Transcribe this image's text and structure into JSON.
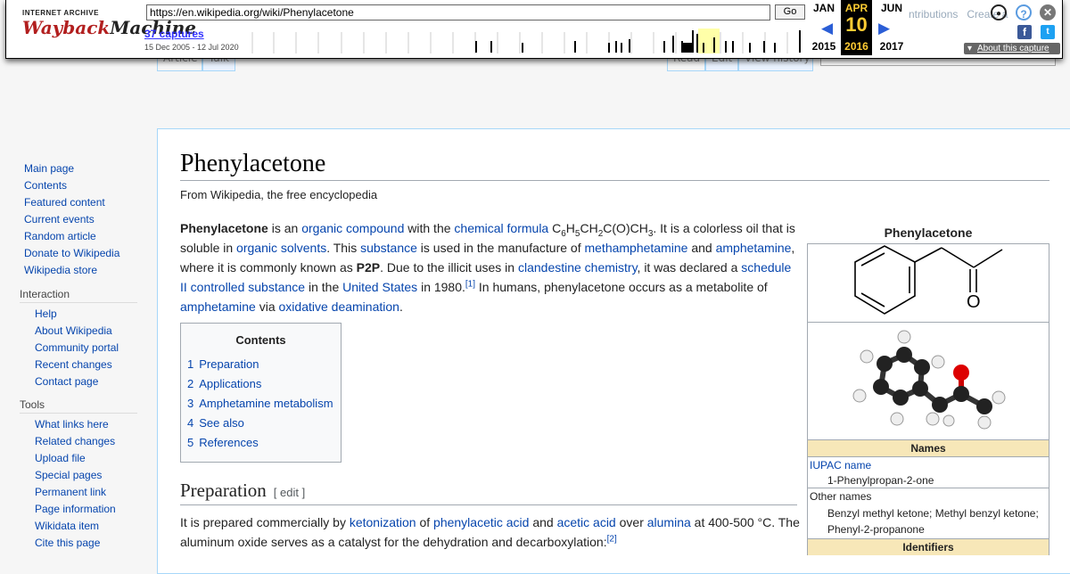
{
  "wayback": {
    "logo_top": "INTERNET ARCHIVE",
    "logo_w": "Wayback",
    "logo_m": "Machine",
    "url": "https://en.wikipedia.org/wiki/Phenylacetone",
    "go_label": "Go",
    "captures": "37 captures",
    "range": "15 Dec 2005 - 12 Jul 2020",
    "prev_month": "JAN",
    "prev_year": "2015",
    "cur_month": "APR",
    "cur_day": "10",
    "cur_year": "2016",
    "next_month": "JUN",
    "next_year": "2017",
    "about": "About this capture",
    "ghost_right": "ntributions   Create a"
  },
  "ghost_tabs": {
    "article": "Article",
    "talk": "Talk",
    "read": "Read",
    "edit": "Edit",
    "history": "View history"
  },
  "sidebar": {
    "main": [
      "Main page",
      "Contents",
      "Featured content",
      "Current events",
      "Random article",
      "Donate to Wikipedia",
      "Wikipedia store"
    ],
    "interaction_label": "Interaction",
    "interaction": [
      "Help",
      "About Wikipedia",
      "Community portal",
      "Recent changes",
      "Contact page"
    ],
    "tools_label": "Tools",
    "tools": [
      "What links here",
      "Related changes",
      "Upload file",
      "Special pages",
      "Permanent link",
      "Page information",
      "Wikidata item",
      "Cite this page"
    ]
  },
  "article": {
    "title": "Phenylacetone",
    "from": "From Wikipedia, the free encyclopedia",
    "lead": {
      "b1": "Phenylacetone",
      "t1": " is an ",
      "l1": "organic compound",
      "t2": " with the ",
      "l2": "chemical formula",
      "f1": " C",
      "s1": "6",
      "f2": "H",
      "s2": "5",
      "f3": "CH",
      "s3": "2",
      "f4": "C(O)CH",
      "s4": "3",
      "t3": ". It is a colorless oil that is soluble in ",
      "l3": "organic solvents",
      "t4": ". This ",
      "l4": "substance",
      "t5": " is used in the manufacture of ",
      "l5": "methamphetamine",
      "t6": " and ",
      "l6": "amphetamine",
      "t7": ", where it is commonly known as ",
      "b2": "P2P",
      "t8": ". Due to the illicit uses in ",
      "l7": "clandestine chemistry",
      "t9": ", it was declared a ",
      "l8": "schedule II controlled substance",
      "t10": " in the ",
      "l9": "United States",
      "t11": " in 1980.",
      "r1": "[1]",
      "t12": " In humans, phenylacetone occurs as a metabolite of ",
      "l10": "amphetamine",
      "t13": " via ",
      "l11": "oxidative deamination",
      "t14": "."
    },
    "toc": {
      "title": "Contents",
      "items": [
        {
          "n": "1",
          "label": "Preparation"
        },
        {
          "n": "2",
          "label": "Applications"
        },
        {
          "n": "3",
          "label": "Amphetamine metabolism"
        },
        {
          "n": "4",
          "label": "See also"
        },
        {
          "n": "5",
          "label": "References"
        }
      ]
    },
    "prep": {
      "heading": "Preparation",
      "edit": "[ edit ]",
      "t1": "It is prepared commercially by ",
      "l1": "ketonization",
      "t2": " of ",
      "l2": "phenylacetic acid",
      "t3": " and ",
      "l3": "acetic acid",
      "t4": " over ",
      "l4": "alumina",
      "t5": " at 400-500 °C. The aluminum oxide serves as a catalyst for the dehydration and decarboxylation:",
      "r1": "[2]"
    }
  },
  "infobox": {
    "title": "Phenylacetone",
    "oxygen": "O",
    "names_header": "Names",
    "iupac_label": "IUPAC name",
    "iupac_value": "1-Phenylpropan-2-one",
    "other_label": "Other names",
    "other_value": "Benzyl methyl ketone; Methyl benzyl ketone; Phenyl-2-propanone",
    "identifiers_header": "Identifiers"
  }
}
